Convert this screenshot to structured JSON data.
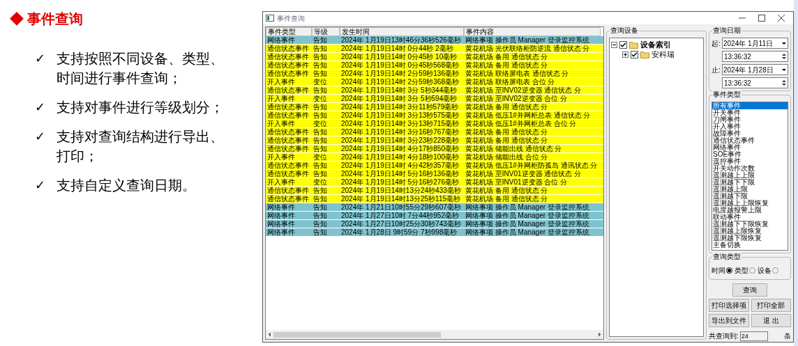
{
  "slide": {
    "title": "◆ 事件查询",
    "bullets": [
      {
        "mark": "✓",
        "text": "支持按照不同设备、类型、时间进行事件查询；"
      },
      {
        "mark": "✓",
        "text": "支持对事件进行等级划分；"
      },
      {
        "mark": "✓",
        "text": "支持对查询结构进行导出、打印；"
      },
      {
        "mark": "✓",
        "text": "支持自定义查询日期。"
      }
    ]
  },
  "window": {
    "title": "事件查询",
    "table": {
      "columns": [
        "事件类型",
        "等级",
        "发生时间",
        "事件内容"
      ],
      "rows": [
        {
          "color": "#7fc3ce",
          "cells": [
            "网络事件",
            "告知",
            "2024年 1月19日13时46分36秒526毫秒",
            "网络事项 操作员 Manager 登录监控系统"
          ]
        },
        {
          "color": "#ffff00",
          "cells": [
            "通信状态事件",
            "告知",
            "2024年 1月19日14时 0分44秒 2毫秒",
            "黄花机场 光伏联络柜防逆流 通信状态 分"
          ]
        },
        {
          "color": "#ffff00",
          "cells": [
            "通信状态事件",
            "告知",
            "2024年 1月19日14时 0分45秒 10毫秒",
            "黄花机场 备用 通信状态 分"
          ]
        },
        {
          "color": "#ffff00",
          "cells": [
            "通信状态事件",
            "告知",
            "2024年 1月19日14时 0分45秒568毫秒",
            "黄花机场 备用 通信状态 分"
          ]
        },
        {
          "color": "#ffff00",
          "cells": [
            "通信状态事件",
            "告知",
            "2024年 1月19日14时 2分59秒136毫秒",
            "黄花机场 联络屏电表 通信状态 分"
          ]
        },
        {
          "color": "#ffff00",
          "cells": [
            "开入事件",
            "变位",
            "2024年 1月19日14时 2分59秒368毫秒",
            "黄花机场 联络屏电表 合位 分"
          ]
        },
        {
          "color": "#ffff00",
          "cells": [
            "通信状态事件",
            "告知",
            "2024年 1月19日14时 3分 5秒344毫秒",
            "黄花机场 至INV02逆变器 通信状态 分"
          ]
        },
        {
          "color": "#ffff00",
          "cells": [
            "开入事件",
            "变位",
            "2024年 1月19日14时 3分 5秒594毫秒",
            "黄花机场 至INV02逆变器 合位 分"
          ]
        },
        {
          "color": "#ffff00",
          "cells": [
            "通信状态事件",
            "告知",
            "2024年 1月19日14时 3分11秒579毫秒",
            "黄花机场 备用 通信状态 分"
          ]
        },
        {
          "color": "#ffff00",
          "cells": [
            "通信状态事件",
            "告知",
            "2024年 1月19日14时 3分13秒575毫秒",
            "黄花机场 低压1#并网柜总表 通信状态 分"
          ]
        },
        {
          "color": "#ffff00",
          "cells": [
            "开入事件",
            "变位",
            "2024年 1月19日14时 3分13秒715毫秒",
            "黄花机场 低压1#并网柜总表 合位 分"
          ]
        },
        {
          "color": "#ffff00",
          "cells": [
            "通信状态事件",
            "告知",
            "2024年 1月19日14时 3分16秒767毫秒",
            "黄花机场 备用 通信状态 分"
          ]
        },
        {
          "color": "#ffff00",
          "cells": [
            "通信状态事件",
            "告知",
            "2024年 1月19日14时 3分23秒228毫秒",
            "黄花机场 备用 通信状态 分"
          ]
        },
        {
          "color": "#ffff00",
          "cells": [
            "通信状态事件",
            "告知",
            "2024年 1月19日14时 4分17秒850毫秒",
            "黄花机场 储能出线 通信状态 分"
          ]
        },
        {
          "color": "#ffff00",
          "cells": [
            "开入事件",
            "变位",
            "2024年 1月19日14时 4分18秒100毫秒",
            "黄花机场 储能出线 合位 分"
          ]
        },
        {
          "color": "#ffff00",
          "cells": [
            "通信状态事件",
            "告知",
            "2024年 1月19日14时 4分42秒357毫秒",
            "黄花机场 低压1#并网柜防孤岛 通讯状态 分"
          ]
        },
        {
          "color": "#ffff00",
          "cells": [
            "通信状态事件",
            "告知",
            "2024年 1月19日14时 5分16秒136毫秒",
            "黄花机场 至INV01逆变器 通信状态 分"
          ]
        },
        {
          "color": "#ffff00",
          "cells": [
            "开入事件",
            "变位",
            "2024年 1月19日14时 5分16秒276毫秒",
            "黄花机场 至INV01逆变器 合位 分"
          ]
        },
        {
          "color": "#ffff00",
          "cells": [
            "通信状态事件",
            "告知",
            "2024年 1月19日14时13分24秒433毫秒",
            "黄花机场 备用 通信状态 分"
          ]
        },
        {
          "color": "#ffff00",
          "cells": [
            "通信状态事件",
            "告知",
            "2024年 1月19日14时13分25秒115毫秒",
            "黄花机场 备用 通信状态 分"
          ]
        },
        {
          "color": "#7fc3ce",
          "cells": [
            "网络事件",
            "告知",
            "2024年 1月21日10时55分29秒607毫秒",
            "网络事项 操作员 Manager 登录监控系统"
          ]
        },
        {
          "color": "#7fc3ce",
          "cells": [
            "网络事件",
            "告知",
            "2024年 1月27日10时 7分44秒952毫秒",
            "网络事项 操作员 Manager 登录监控系统"
          ]
        },
        {
          "color": "#7fc3ce",
          "cells": [
            "网络事件",
            "告知",
            "2024年 1月27日10时25分30秒743毫秒",
            "网络事项 操作员 Manager 登录监控系统"
          ]
        },
        {
          "color": "#7fc3ce",
          "cells": [
            "网络事件",
            "告知",
            "2024年 1月28日 9时59分 7秒998毫秒",
            "网络事项 操作员 Manager 登录监控系统"
          ]
        }
      ]
    },
    "devices": {
      "label": "查询设备",
      "tree": [
        {
          "label": "设备索引",
          "checked": true,
          "expanded": true,
          "children": [
            {
              "label": "安科瑞",
              "checked": true,
              "expanded": false
            }
          ]
        }
      ]
    },
    "date": {
      "label": "查询日期",
      "ranges": [
        {
          "label": "起:",
          "date": "2024年 1月11日",
          "time": "13:36:32"
        },
        {
          "label": "止:",
          "date": "2024年 1月28日",
          "time": "13:36:32"
        }
      ]
    },
    "event_types": {
      "label": "事件类型",
      "items": [
        {
          "label": "所有事件",
          "selected": true
        },
        {
          "label": "开关事件",
          "selected": false
        },
        {
          "label": "刀闸事件",
          "selected": false
        },
        {
          "label": "开入事件",
          "selected": false
        },
        {
          "label": "故障事件",
          "selected": false
        },
        {
          "label": "通信状态事件",
          "selected": false
        },
        {
          "label": "网络事件",
          "selected": false
        },
        {
          "label": "SOE事件",
          "selected": false
        },
        {
          "label": "遥控事件",
          "selected": false
        },
        {
          "label": "开关动作次数",
          "selected": false
        },
        {
          "label": "遥测越上上限",
          "selected": false
        },
        {
          "label": "遥测越下下限",
          "selected": false
        },
        {
          "label": "遥测越上限",
          "selected": false
        },
        {
          "label": "遥测越下限",
          "selected": false
        },
        {
          "label": "遥测越上上限恢复",
          "selected": false
        },
        {
          "label": "电度越报警上限",
          "selected": false
        },
        {
          "label": "联动事件",
          "selected": false
        },
        {
          "label": "遥测越下下限恢复",
          "selected": false
        },
        {
          "label": "遥测越上限恢复",
          "selected": false
        },
        {
          "label": "遥测越下限恢复",
          "selected": false
        },
        {
          "label": "主备切换",
          "selected": false
        }
      ]
    },
    "query_type": {
      "label": "查询类型",
      "options": [
        {
          "label": "时间",
          "selected": true
        },
        {
          "label": "类型",
          "selected": false
        },
        {
          "label": "设备",
          "selected": false
        }
      ]
    },
    "buttons": [
      [
        "查询"
      ],
      [
        "打印选择项",
        "打印全部"
      ],
      [
        "导出到文件",
        "退 出"
      ]
    ],
    "count": {
      "label": "共查询到:",
      "value": "24",
      "unit": "条"
    }
  }
}
